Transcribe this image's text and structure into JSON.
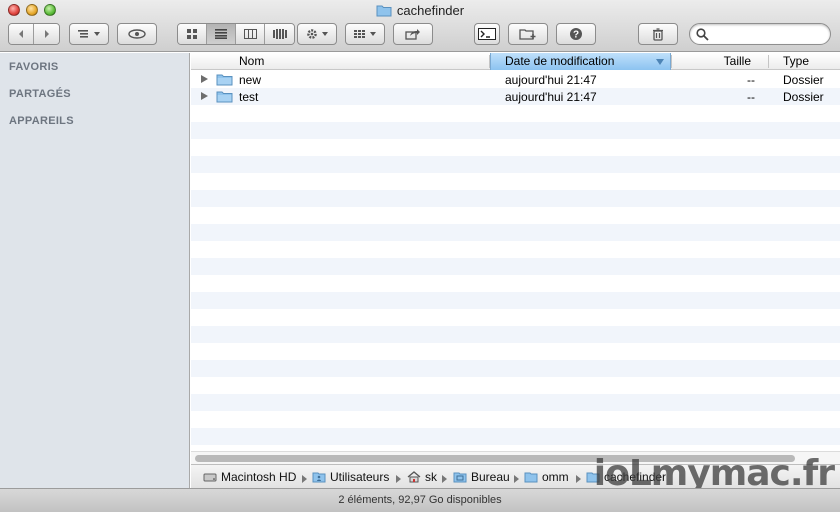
{
  "window": {
    "title": "cachefinder"
  },
  "sidebar": {
    "sections": [
      "FAVORIS",
      "PARTAGÉS",
      "APPAREILS"
    ]
  },
  "columns": {
    "name": "Nom",
    "date": "Date de modification",
    "size": "Taille",
    "type": "Type"
  },
  "rows": [
    {
      "name": "new",
      "date": "aujourd'hui 21:47",
      "size": "--",
      "type": "Dossier"
    },
    {
      "name": "test",
      "date": "aujourd'hui 21:47",
      "size": "--",
      "type": "Dossier"
    }
  ],
  "path": [
    "Macintosh HD",
    "Utilisateurs",
    "sk",
    "Bureau",
    "omm",
    "cachefinder"
  ],
  "watermark": "ioLmymac.fr",
  "status": "2 éléments, 92,97 Go disponibles",
  "colors": {
    "sidebar": "#dfe4ea",
    "sorted_header": "#a9d2f6",
    "row_alt": "#f1f5fb",
    "folder": "#8fc3ec"
  }
}
